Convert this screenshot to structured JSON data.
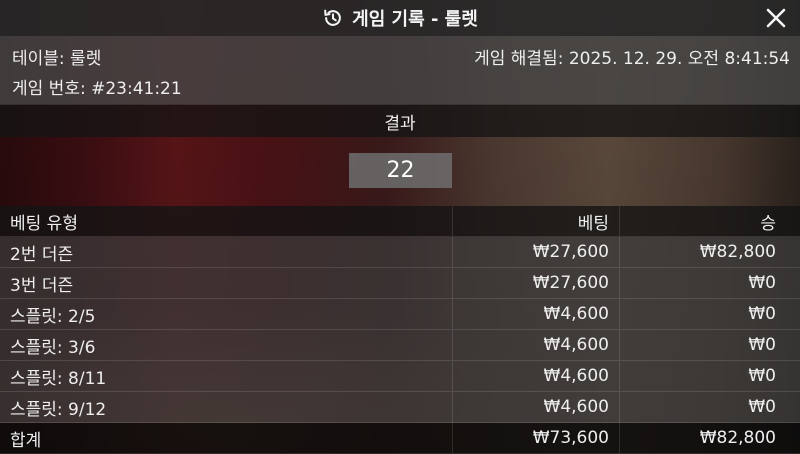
{
  "dialog": {
    "title": "게임 기록 - 룰렛",
    "icons": {
      "title": "history-icon",
      "close": "close-icon"
    }
  },
  "info": {
    "table": "테이블: 룰렛",
    "game_number": "게임 번호: #23:41:21",
    "resolved_at": "게임 해결됨: 2025. 12. 29. 오전 8:41:54"
  },
  "result": {
    "header": "결과",
    "value": "22"
  },
  "bets_table": {
    "columns": [
      "베팅 유형",
      "베팅",
      "승"
    ],
    "rows": [
      {
        "type": "2번 더즌",
        "bet": "₩27,600",
        "win": "₩82,800"
      },
      {
        "type": "3번 더즌",
        "bet": "₩27,600",
        "win": "₩0"
      },
      {
        "type": "스플릿: 2/5",
        "bet": "₩4,600",
        "win": "₩0"
      },
      {
        "type": "스플릿: 3/6",
        "bet": "₩4,600",
        "win": "₩0"
      },
      {
        "type": "스플릿: 8/11",
        "bet": "₩4,600",
        "win": "₩0"
      },
      {
        "type": "스플릿: 9/12",
        "bet": "₩4,600",
        "win": "₩0"
      }
    ],
    "total": {
      "label": "합계",
      "bet": "₩73,600",
      "win": "₩82,800"
    }
  }
}
